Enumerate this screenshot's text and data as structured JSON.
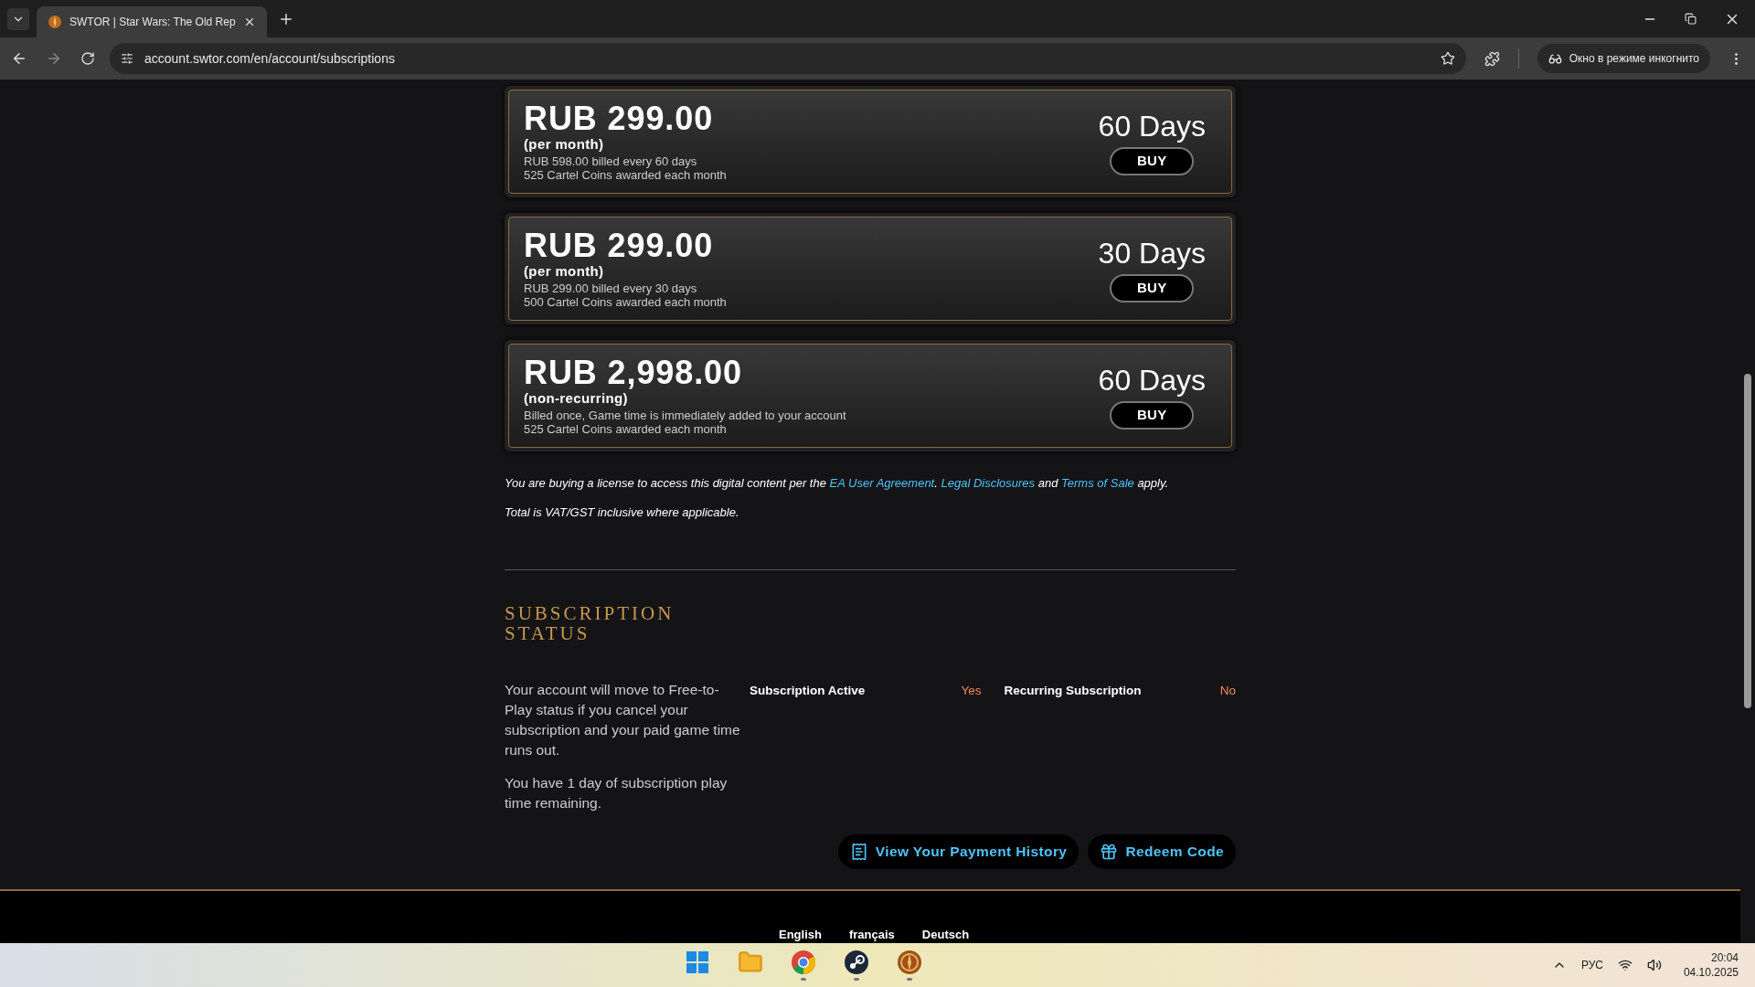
{
  "browser": {
    "tab": {
      "title": "SWTOR | Star Wars: The Old Rep",
      "selected": true
    },
    "address": "account.swtor.com/en/account/subscriptions",
    "incognito_label": "Окно в режиме инкогнито"
  },
  "plans": [
    {
      "price": "RUB 299.00",
      "term": "(per month)",
      "billing": "RUB 598.00 billed every 60 days",
      "coins": "525 Cartel Coins awarded each month",
      "duration": "60 Days",
      "button": "BUY"
    },
    {
      "price": "RUB 299.00",
      "term": "(per month)",
      "billing": "RUB 299.00 billed every 30 days",
      "coins": "500 Cartel Coins awarded each month",
      "duration": "30 Days",
      "button": "BUY"
    },
    {
      "price": "RUB 2,998.00",
      "term": "(non-recurring)",
      "billing": "Billed once, Game time is immediately added to your account",
      "coins": "525 Cartel Coins awarded each month",
      "duration": "60 Days",
      "button": "BUY"
    }
  ],
  "legal": {
    "before": "You are buying a license to access this digital content per the",
    "links": [
      "EA User Agreement",
      "Legal Disclosures",
      "Terms of Sale"
    ],
    "sep1": ".",
    "and": "and",
    "after": "apply.",
    "vat": "Total is VAT/GST inclusive where applicable."
  },
  "status": {
    "heading_lines": [
      "SUBSCRIPTION",
      "STATUS"
    ],
    "paragraphs": [
      "Your account will move to Free-to-Play status if you cancel your subscription and your paid game time runs out.",
      "You have 1 day of subscription play time remaining."
    ],
    "fields": [
      {
        "label": "Subscription Active",
        "value": "Yes"
      },
      {
        "label": "Recurring Subscription",
        "value": "No"
      }
    ]
  },
  "actions": [
    {
      "kind": "receipt",
      "label": "View Your Payment History"
    },
    {
      "kind": "gift",
      "label": "Redeem Code"
    }
  ],
  "footer_languages": [
    "English",
    "français",
    "Deutsch"
  ],
  "taskbar": {
    "apps": [
      {
        "kind": "windows",
        "running": false
      },
      {
        "kind": "folder",
        "running": false
      },
      {
        "kind": "chrome",
        "running": true
      },
      {
        "kind": "steam",
        "running": true
      },
      {
        "kind": "game",
        "running": true
      }
    ],
    "language": "РУС",
    "time": "20:04",
    "date": "04.10.2025"
  }
}
